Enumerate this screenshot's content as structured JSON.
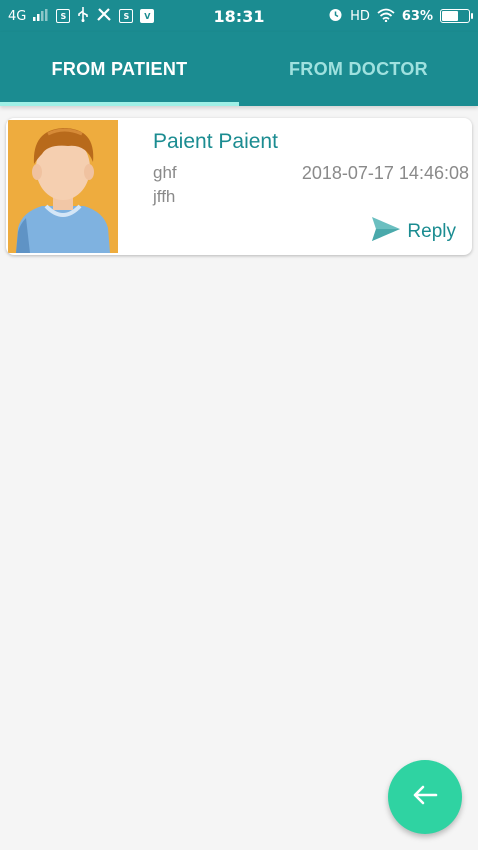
{
  "status_bar": {
    "network": "4G",
    "time": "18:31",
    "hd": "HD",
    "battery": "63%",
    "battery_level": 0.63
  },
  "tabs": [
    {
      "label": "FROM PATIENT",
      "active": true
    },
    {
      "label": "FROM DOCTOR",
      "active": false
    }
  ],
  "messages": [
    {
      "sender": "Paient Paient",
      "subject": "ghf",
      "body": "jffh",
      "timestamp": "2018-07-17 14:46:08",
      "reply_label": "Reply"
    }
  ],
  "colors": {
    "primary": "#1b8c91",
    "indicator": "#9ff0e6",
    "fab": "#2fd3a2",
    "avatar_bg": "#eeac3e"
  },
  "icons": {
    "reply": "send-icon",
    "fab": "arrow-left-icon"
  }
}
